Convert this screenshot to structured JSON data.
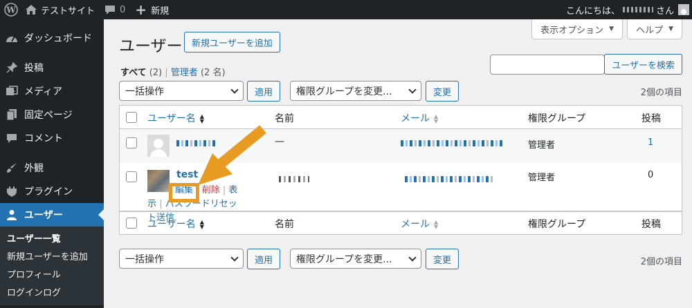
{
  "adminbar": {
    "site_name": "テストサイト",
    "comments_count": "0",
    "new_label": "新規",
    "greeting": "こんにちは、",
    "greeting_suffix": "さん"
  },
  "sidebar": {
    "items": [
      {
        "label": "ダッシュボード",
        "icon": "dashboard-icon"
      },
      {
        "label": "投稿",
        "icon": "pin-icon"
      },
      {
        "label": "メディア",
        "icon": "media-icon"
      },
      {
        "label": "固定ページ",
        "icon": "page-icon"
      },
      {
        "label": "コメント",
        "icon": "comment-icon"
      },
      {
        "label": "外観",
        "icon": "brush-icon"
      },
      {
        "label": "プラグイン",
        "icon": "plugin-icon"
      },
      {
        "label": "ユーザー",
        "icon": "user-icon"
      }
    ],
    "submenu": [
      "ユーザー一覧",
      "新規ユーザーを追加",
      "プロフィール",
      "ログインログ"
    ]
  },
  "screen_options": {
    "screen_label": "表示オプション",
    "help_label": "ヘルプ"
  },
  "page": {
    "title": "ユーザー",
    "add_new": "新規ユーザーを追加",
    "filter_all": "すべて",
    "filter_all_count": "(2)",
    "filter_sep": "|",
    "filter_admin": "管理者",
    "filter_admin_count": "(2 名)",
    "search_button": "ユーザーを検索",
    "bulk_action": "一括操作",
    "apply": "適用",
    "role_change": "権限グループを変更...",
    "change": "変更",
    "item_count": "2個の項目"
  },
  "table": {
    "columns": [
      "ユーザー名",
      "名前",
      "メール",
      "権限グループ",
      "投稿"
    ],
    "rows": [
      {
        "username": "",
        "name": "—",
        "role": "管理者",
        "posts": "1"
      },
      {
        "username": "test",
        "name": "",
        "role": "管理者",
        "posts": "0",
        "actions": {
          "edit": "編集",
          "delete": "削除",
          "view": "表示",
          "reset": "パスワードリセット送信"
        }
      }
    ]
  },
  "colors": {
    "accent": "#2271b1",
    "adminbar": "#1d2327",
    "annotation": "#e89b22",
    "delete": "#d63638"
  }
}
